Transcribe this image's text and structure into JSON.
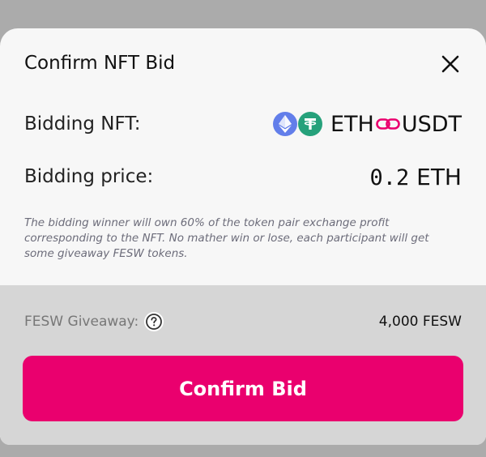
{
  "modal": {
    "title": "Confirm NFT Bid",
    "close_icon": "close-icon"
  },
  "nft_row": {
    "label": "Bidding NFT:",
    "token_a": "ETH",
    "token_b": "USDT",
    "token_a_icon": "ethereum-icon",
    "token_b_icon": "tether-icon",
    "link_icon": "link-icon"
  },
  "price_row": {
    "label": "Bidding price:",
    "amount": "0.2",
    "unit": "ETH"
  },
  "note": "The bidding winner will own 60% of the token pair exchange profit corresponding to the NFT. No mather win or lose, each participant will get some giveaway FESW tokens.",
  "giveaway": {
    "label": "FESW Giveaway:",
    "help_icon": "help-icon",
    "value": "4,000 FESW"
  },
  "confirm_button": "Confirm Bid",
  "colors": {
    "accent": "#ea006e",
    "eth": "#627eea",
    "usdt": "#26a17b"
  }
}
